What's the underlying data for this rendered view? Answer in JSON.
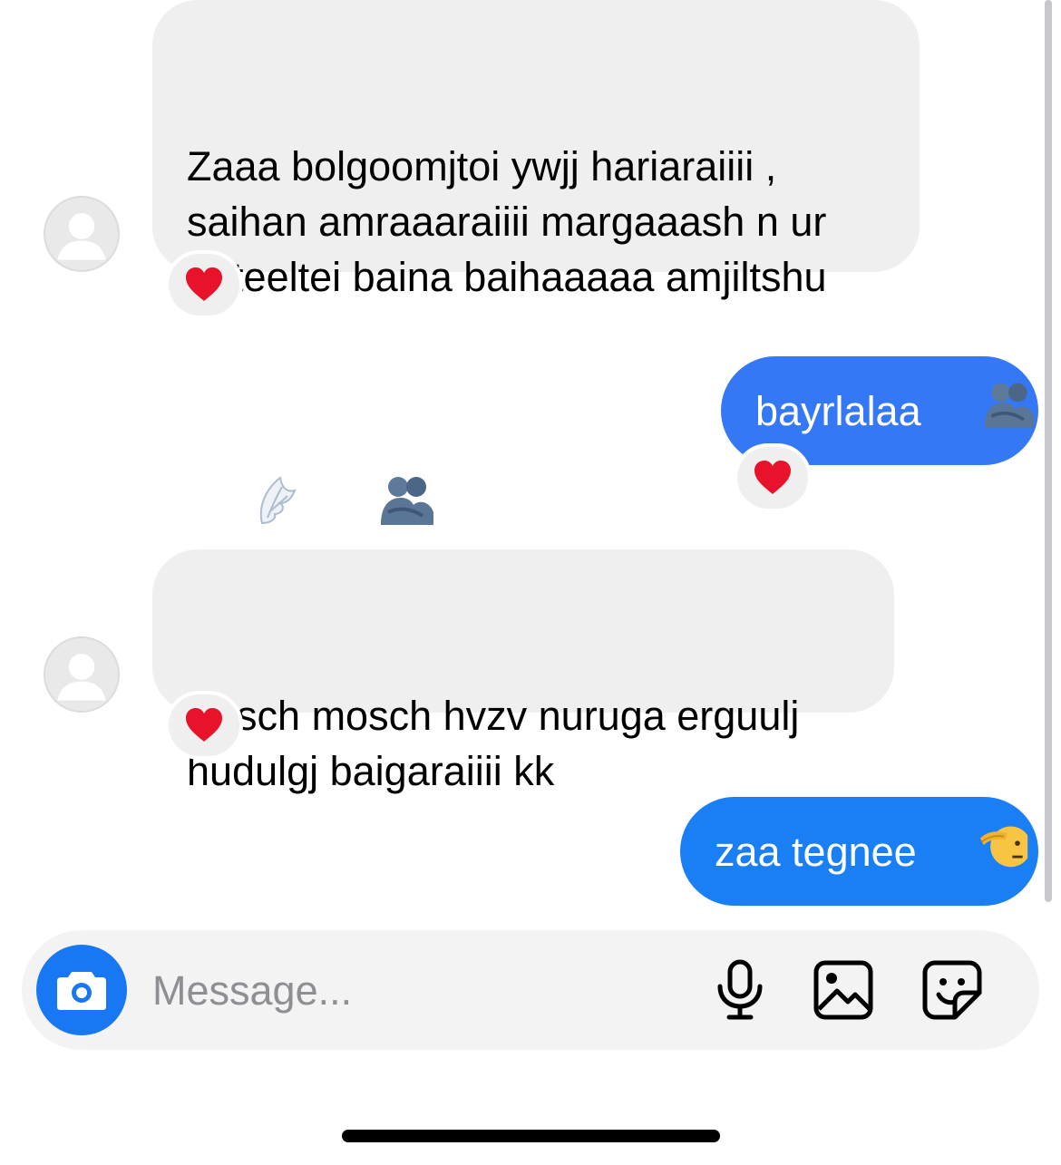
{
  "thread": {
    "messages": [
      {
        "direction": "incoming",
        "text": "Zaaa bolgoomjtoi ywjj hariaraiiii ,\nsaihan amraaaraiiii margaaash n ur\nbuteeltei baina baihaaaaa amjiltshu",
        "emojis": [
          "wing-emoji",
          "people-hugging-emoji"
        ],
        "reaction": "red-heart-emoji"
      },
      {
        "direction": "outgoing",
        "text": "bayrlalaa",
        "emojis": [
          "people-hugging-emoji"
        ],
        "reaction": "red-heart-emoji"
      },
      {
        "direction": "incoming",
        "text": "Bosch mosch hvzv nuruga erguulj\nhudulgj baigaraiiii kk",
        "reaction": "red-heart-emoji"
      },
      {
        "direction": "outgoing",
        "text": "zaa tegnee",
        "emojis": [
          "saluting-face-emoji"
        ]
      }
    ]
  },
  "composer": {
    "placeholder": "Message...",
    "value": "",
    "icons": [
      "camera-icon",
      "microphone-icon",
      "gallery-icon",
      "sticker-icon"
    ]
  },
  "colors": {
    "incoming_bubble": "#efeff0",
    "outgoing_bubble": "#3478f6",
    "outgoing_bubble_latest": "#1a7ef5",
    "camera_button": "#1877f2",
    "placeholder": "#8e8e93"
  }
}
